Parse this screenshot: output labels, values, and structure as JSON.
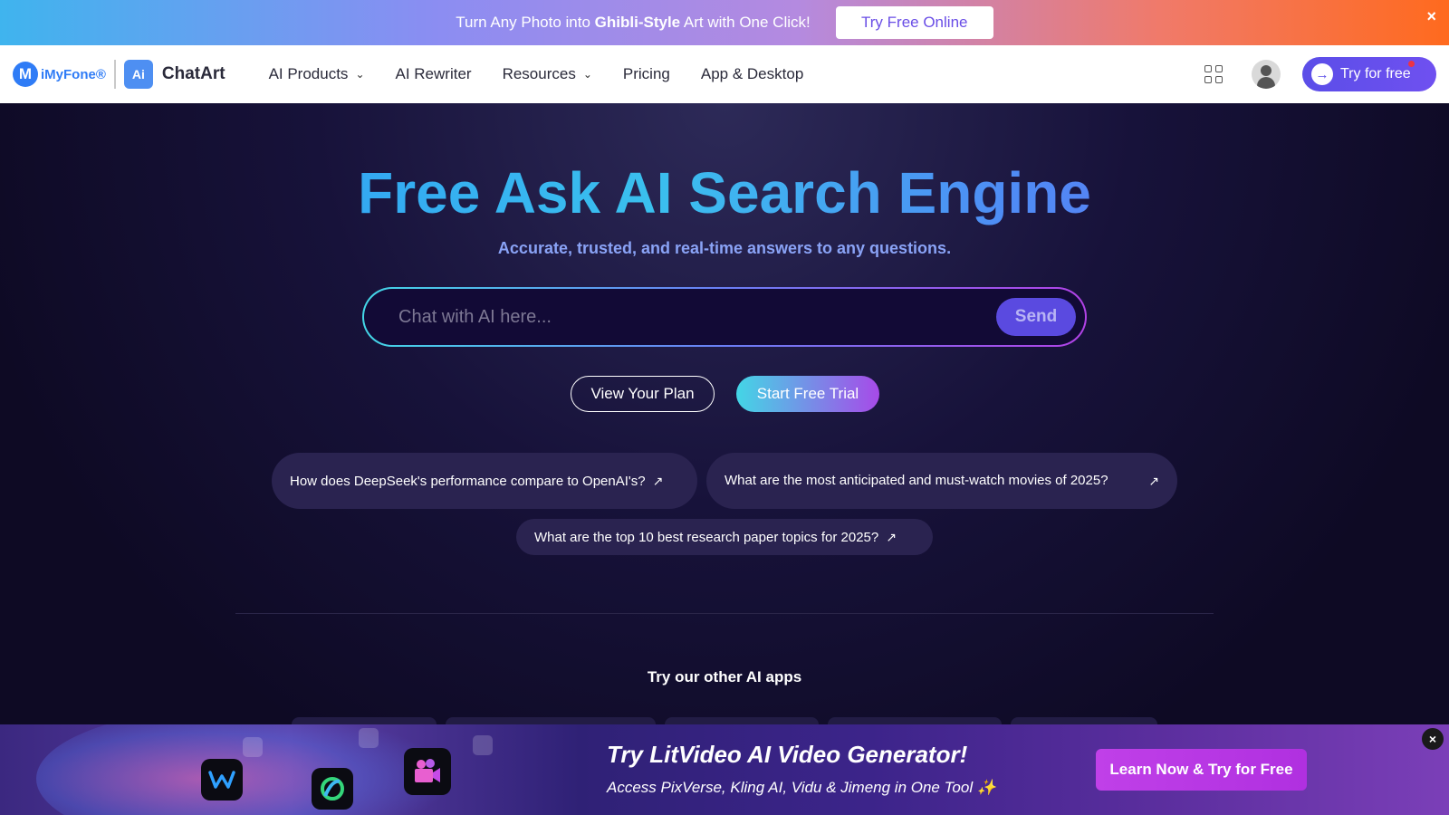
{
  "promo": {
    "text_before": "Turn Any Photo into ",
    "text_bold": "Ghibli-Style",
    "text_after": " Art with One Click!",
    "button": "Try Free Online",
    "close": "×"
  },
  "nav": {
    "brand_imyfone": "iMyFone®",
    "brand_chatart": "ChatArt",
    "links": [
      "AI Products",
      "AI Rewriter",
      "Resources",
      "Pricing",
      "App & Desktop"
    ],
    "try_button": "Try for free"
  },
  "hero": {
    "title": "Free Ask AI Search Engine",
    "subtitle": "Accurate, trusted, and real-time answers to any questions.",
    "search_placeholder": "Chat with AI here...",
    "send": "Send",
    "view_plan": "View Your Plan",
    "start_trial": "Start Free Trial",
    "suggestions": [
      "How does DeepSeek's performance compare to OpenAI's?",
      "What are the most anticipated and must-watch movies of 2025?",
      "What are the top 10 best research paper topics for 2025?"
    ],
    "other_apps_heading": "Try our other AI apps"
  },
  "ad": {
    "title": "Try LitVideo AI Video Generator!",
    "subtitle": "Access PixVerse, Kling AI, Vidu & Jimeng in One Tool ✨",
    "button": "Learn Now & Try for Free",
    "close": "×"
  },
  "colors": {
    "accent": "#5b4ee8",
    "background": "#0e0a24",
    "title_gradient_start": "#2b8cf6",
    "title_gradient_end": "#6b6cf2"
  }
}
